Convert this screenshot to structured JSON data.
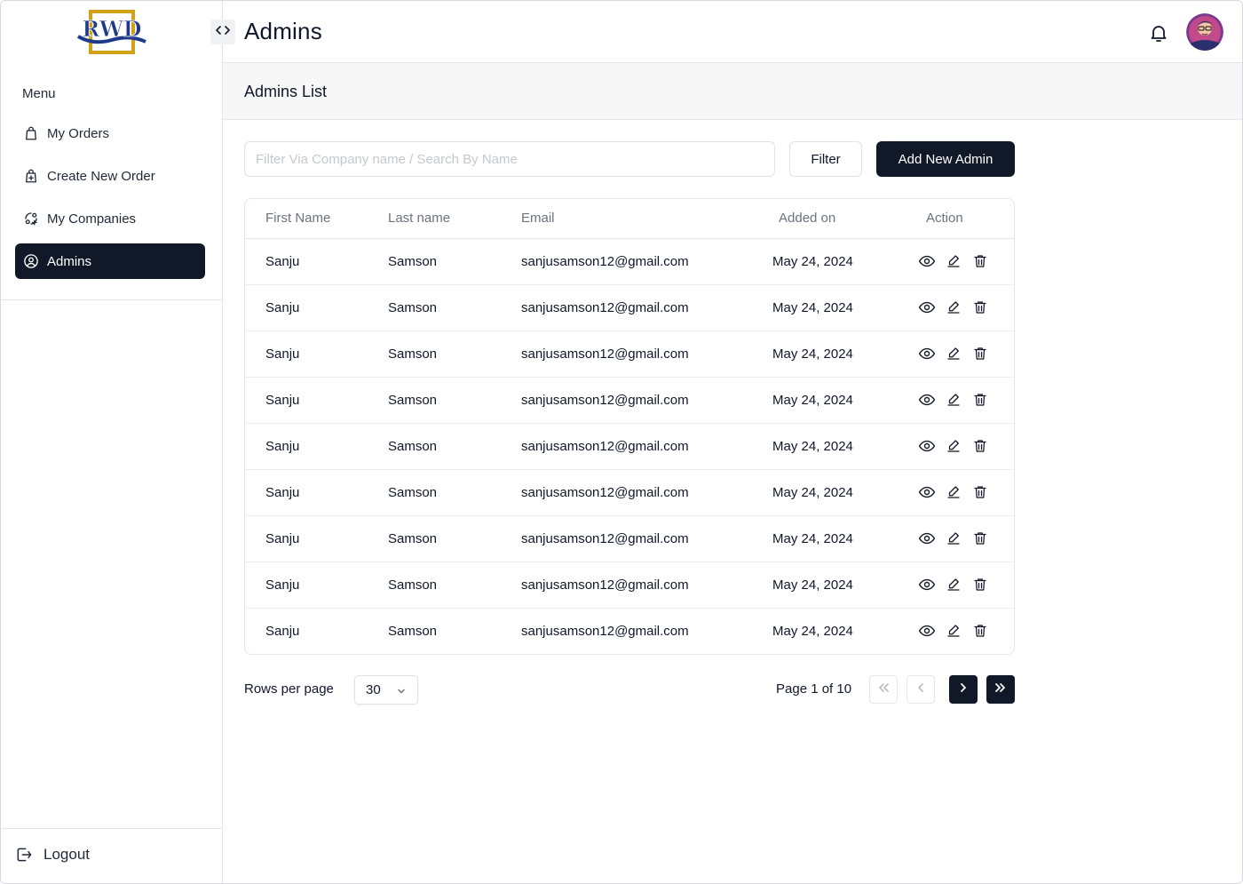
{
  "brand": {
    "logo_text": "RWD"
  },
  "header": {
    "title": "Admins"
  },
  "sidebar": {
    "menu_title": "Menu",
    "items": [
      {
        "label": "My Orders",
        "icon": "shopping-bag-icon",
        "active": false
      },
      {
        "label": "Create New Order",
        "icon": "bag-plus-icon",
        "active": false
      },
      {
        "label": "My Companies",
        "icon": "companies-icon",
        "active": false
      },
      {
        "label": "Admins",
        "icon": "user-circle-icon",
        "active": true
      }
    ],
    "logout_label": "Logout"
  },
  "section": {
    "title": "Admins List"
  },
  "toolbar": {
    "search_placeholder": "Filter Via Company name / Search By Name",
    "filter_label": "Filter",
    "add_label": "Add New Admin"
  },
  "table": {
    "columns": [
      "First Name",
      "Last name",
      "Email",
      "Added on",
      "Action"
    ],
    "rows": [
      {
        "first": "Sanju",
        "last": "Samson",
        "email": "sanjusamson12@gmail.com",
        "added": "May 24, 2024"
      },
      {
        "first": "Sanju",
        "last": "Samson",
        "email": "sanjusamson12@gmail.com",
        "added": "May 24, 2024"
      },
      {
        "first": "Sanju",
        "last": "Samson",
        "email": "sanjusamson12@gmail.com",
        "added": "May 24, 2024"
      },
      {
        "first": "Sanju",
        "last": "Samson",
        "email": "sanjusamson12@gmail.com",
        "added": "May 24, 2024"
      },
      {
        "first": "Sanju",
        "last": "Samson",
        "email": "sanjusamson12@gmail.com",
        "added": "May 24, 2024"
      },
      {
        "first": "Sanju",
        "last": "Samson",
        "email": "sanjusamson12@gmail.com",
        "added": "May 24, 2024"
      },
      {
        "first": "Sanju",
        "last": "Samson",
        "email": "sanjusamson12@gmail.com",
        "added": "May 24, 2024"
      },
      {
        "first": "Sanju",
        "last": "Samson",
        "email": "sanjusamson12@gmail.com",
        "added": "May 24, 2024"
      },
      {
        "first": "Sanju",
        "last": "Samson",
        "email": "sanjusamson12@gmail.com",
        "added": "May 24, 2024"
      }
    ],
    "action_icons": [
      "eye-icon",
      "pencil-icon",
      "trash-icon"
    ]
  },
  "pagination": {
    "rows_per_page_label": "Rows per page",
    "rows_per_page_value": "30",
    "page_info": "Page 1 of 10"
  },
  "colors": {
    "primary_dark": "#111827",
    "border": "#e4e6ea",
    "muted_text": "#6b7280",
    "logo_blue": "#1e3a8a",
    "logo_gold": "#d4a017"
  }
}
